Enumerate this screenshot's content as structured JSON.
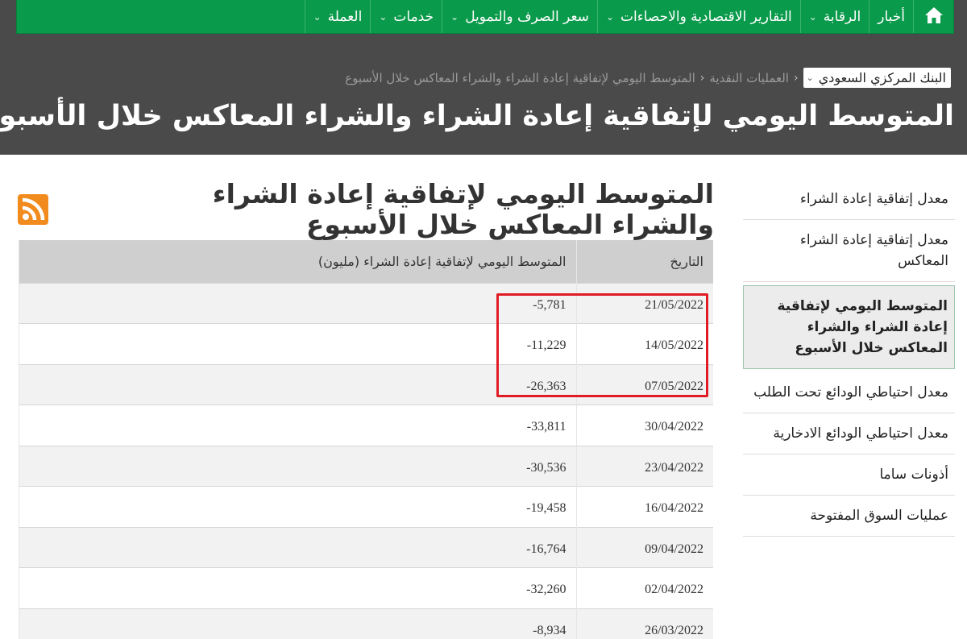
{
  "nav": {
    "items": [
      {
        "label": "أخبار",
        "has_dropdown": false
      },
      {
        "label": "الرقابة",
        "has_dropdown": true
      },
      {
        "label": "التقارير الاقتصادية والاحصاءات",
        "has_dropdown": true
      },
      {
        "label": "سعر الصرف والتمويل",
        "has_dropdown": true
      },
      {
        "label": "خدمات",
        "has_dropdown": true
      },
      {
        "label": "العملة",
        "has_dropdown": true
      }
    ],
    "chevron": "⌄"
  },
  "breadcrumb": {
    "home": "البنك المركزي السعودي",
    "items": [
      "العمليات النقدية",
      "المتوسط اليومي لإتفاقية إعادة الشراء والشراء المعاكس خلال الأسبوع"
    ],
    "separator": "‹"
  },
  "hero_title": "المتوسط اليومي لإتفاقية إعادة الشراء والشراء المعاكس خلال الأسبوع",
  "sidebar": {
    "items": [
      {
        "label": "معدل إتفاقية إعادة الشراء",
        "active": false
      },
      {
        "label": "معدل إتفاقية إعادة الشراء المعاكس",
        "active": false
      },
      {
        "label": "المتوسط اليومي لإتفاقية إعادة الشراء والشراء المعاكس خلال الأسبوع",
        "active": true
      },
      {
        "label": "معدل احتياطي الودائع تحت الطلب",
        "active": false
      },
      {
        "label": "معدل احتياطي الودائع الادخارية",
        "active": false
      },
      {
        "label": "أذونات ساما",
        "active": false
      },
      {
        "label": "عمليات السوق المفتوحة",
        "active": false
      }
    ]
  },
  "main": {
    "title": "المتوسط اليومي لإتفاقية إعادة الشراء والشراء المعاكس خلال الأسبوع",
    "rss_icon": "rss-feed-icon",
    "table": {
      "headers": [
        "التاريخ",
        "المتوسط اليومي لإتفاقية إعادة الشراء (مليون)"
      ],
      "rows": [
        {
          "date": "21/05/2022",
          "value": "-5,781"
        },
        {
          "date": "14/05/2022",
          "value": "-11,229"
        },
        {
          "date": "07/05/2022",
          "value": "-26,363"
        },
        {
          "date": "30/04/2022",
          "value": "-33,811"
        },
        {
          "date": "23/04/2022",
          "value": "-30,536"
        },
        {
          "date": "16/04/2022",
          "value": "-19,458"
        },
        {
          "date": "09/04/2022",
          "value": "-16,764"
        },
        {
          "date": "02/04/2022",
          "value": "-32,260"
        },
        {
          "date": "26/03/2022",
          "value": "-8,934"
        }
      ]
    }
  },
  "colors": {
    "nav_green": "#0a9a4b",
    "header_gray": "#4a4a4a",
    "rss_orange": "#f28b1d",
    "highlight_red": "#e01b24"
  }
}
